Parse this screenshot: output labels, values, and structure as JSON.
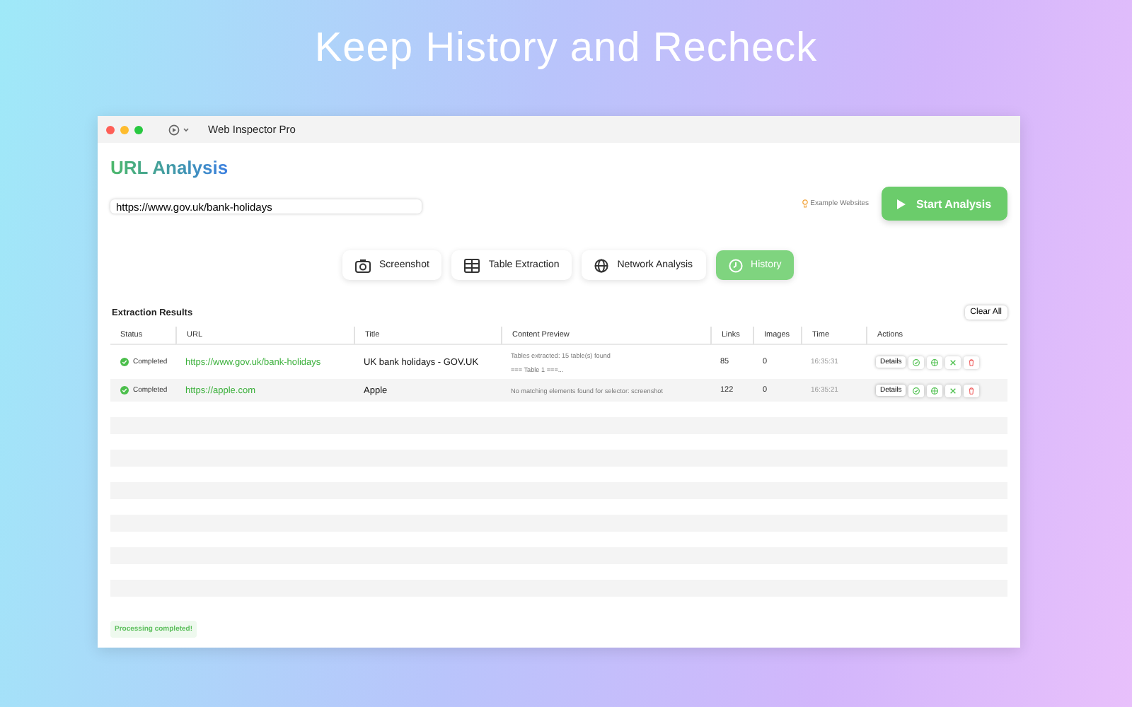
{
  "headline": "Keep History and Recheck",
  "window": {
    "title": "Web Inspector Pro"
  },
  "heading": "URL Analysis",
  "url_field": {
    "value": "https://www.gov.uk/bank-holidays"
  },
  "example_link": "Example Websites",
  "start_button": "Start Analysis",
  "tabs": [
    {
      "label": "Screenshot",
      "selected": false
    },
    {
      "label": "Table Extraction",
      "selected": false
    },
    {
      "label": "Network Analysis",
      "selected": false
    },
    {
      "label": "History",
      "selected": true
    }
  ],
  "results": {
    "title": "Extraction Results",
    "clear_button": "Clear All",
    "columns": [
      "Status",
      "URL",
      "Title",
      "Content Preview",
      "Links",
      "Images",
      "Time",
      "Actions"
    ],
    "rows": [
      {
        "status": "Completed",
        "url": "https://www.gov.uk/bank-holidays",
        "title": "UK bank holidays - GOV.UK",
        "preview": [
          "Tables extracted: 15 table(s) found",
          "=== Table 1 ===..."
        ],
        "links": "85",
        "images": "0",
        "time": "16:35:31",
        "details": "Details"
      },
      {
        "status": "Completed",
        "url": "https://apple.com",
        "title": "Apple",
        "preview": [
          "No matching elements found for selector: screenshot"
        ],
        "links": "122",
        "images": "0",
        "time": "16:35:21",
        "details": "Details"
      }
    ]
  },
  "status_message": "Processing completed!"
}
